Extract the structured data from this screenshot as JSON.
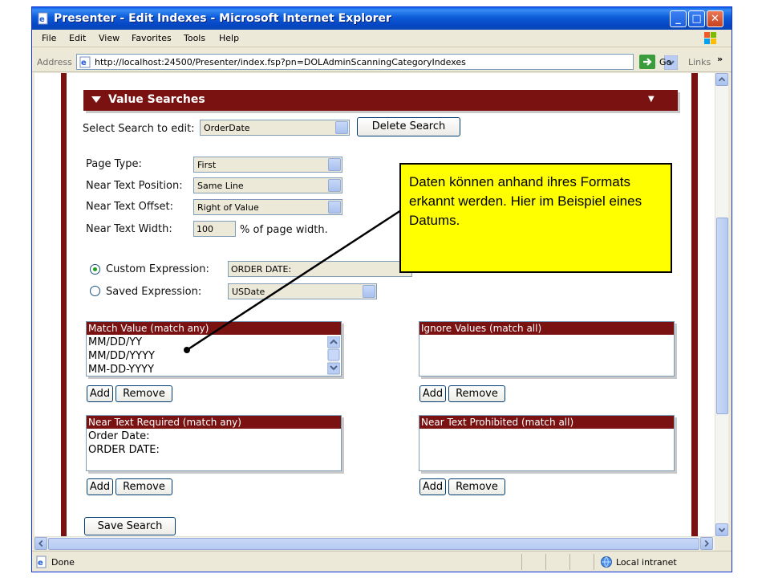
{
  "window": {
    "title": "Presenter - Edit Indexes - Microsoft Internet Explorer",
    "min_glyph": "_",
    "max_glyph": "□",
    "close_glyph": "✕"
  },
  "menu": {
    "items": [
      "File",
      "Edit",
      "View",
      "Favorites",
      "Tools",
      "Help"
    ]
  },
  "address": {
    "label": "Address",
    "url": "http://localhost:24500/Presenter/index.fsp?pn=DOLAdminScanningCategoryIndexes",
    "go": "Go",
    "links": "Links",
    "more": "»"
  },
  "section": {
    "title": "Value Searches",
    "collapse_glyph": "▼"
  },
  "search": {
    "label": "Select Search to edit:",
    "selected": "OrderDate",
    "delete_button": "Delete Search"
  },
  "form": {
    "page_type_label": "Page Type:",
    "page_type_value": "First",
    "near_pos_label": "Near Text Position:",
    "near_pos_value": "Same Line",
    "near_offset_label": "Near Text Offset:",
    "near_offset_value": "Right of Value",
    "near_width_label": "Near Text Width:",
    "near_width_value": "100",
    "near_width_suffix": "% of page width."
  },
  "expression": {
    "custom_label": "Custom Expression:",
    "custom_value": "ORDER DATE:",
    "saved_label": "Saved Expression:",
    "saved_value": "USDate",
    "selected": "custom"
  },
  "lists": {
    "match": {
      "header": "Match Value (match any)",
      "items": [
        "MM/DD/YY",
        "MM/DD/YYYY",
        "MM-DD-YYYY"
      ]
    },
    "ignore": {
      "header": "Ignore Values (match all)",
      "items": []
    },
    "near_required": {
      "header": "Near Text Required (match any)",
      "items": [
        "Order Date:",
        "ORDER DATE:"
      ]
    },
    "near_prohibited": {
      "header": "Near Text Prohibited (match all)",
      "items": []
    },
    "add_label": "Add",
    "remove_label": "Remove"
  },
  "save_button": "Save Search",
  "callout": {
    "text": "Daten können anhand ihres Formats erkannt werden. Hier im Beispiel eines Datums."
  },
  "status": {
    "text": "Done",
    "zone": "Local intranet"
  },
  "colors": {
    "maroon": "#7a1212",
    "callout": "#ffff00",
    "xp_blue": "#0a5fe4"
  }
}
